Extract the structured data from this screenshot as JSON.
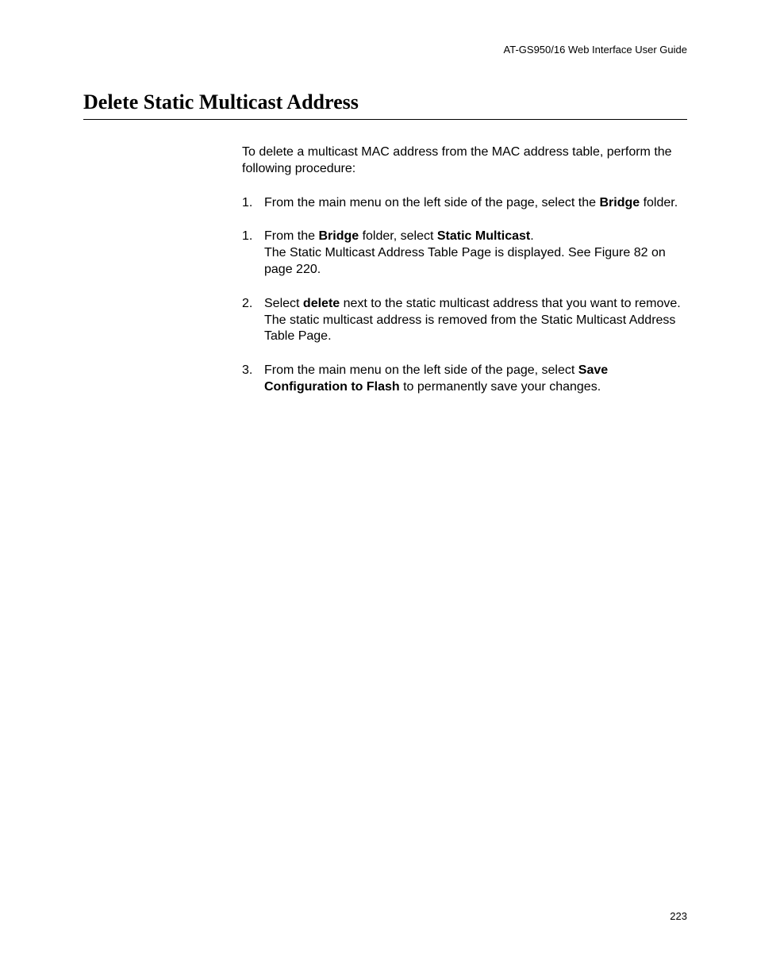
{
  "header": {
    "doc_title": "AT-GS950/16  Web Interface User Guide"
  },
  "title": "Delete Static Multicast Address",
  "intro": "To delete a multicast MAC address from the MAC address table, perform the following procedure:",
  "steps": [
    {
      "num": "1.",
      "parts": [
        {
          "t": "From the main menu on the left side of the page, select the ",
          "b": false
        },
        {
          "t": "Bridge",
          "b": true
        },
        {
          "t": " folder.",
          "b": false
        }
      ]
    },
    {
      "num": "1.",
      "parts": [
        {
          "t": "From the ",
          "b": false
        },
        {
          "t": "Bridge",
          "b": true
        },
        {
          "t": " folder, select ",
          "b": false
        },
        {
          "t": "Static Multicast",
          "b": true
        },
        {
          "t": ".",
          "b": false
        },
        {
          "br": true
        },
        {
          "t": "The Static Multicast Address Table Page is displayed. See Figure 82 on page 220.",
          "b": false
        }
      ]
    },
    {
      "num": "2.",
      "parts": [
        {
          "t": "Select ",
          "b": false
        },
        {
          "t": "delete",
          "b": true
        },
        {
          "t": " next to the static multicast address that you want to remove.",
          "b": false
        },
        {
          "br": true
        },
        {
          "t": "The static multicast address is removed from the Static Multicast Address Table Page.",
          "b": false
        }
      ]
    },
    {
      "num": "3.",
      "parts": [
        {
          "t": "From the main menu on the left side of the page, select ",
          "b": false
        },
        {
          "t": "Save Configuration to Flash",
          "b": true
        },
        {
          "t": " to permanently save your changes.",
          "b": false
        }
      ]
    }
  ],
  "page_number": "223"
}
